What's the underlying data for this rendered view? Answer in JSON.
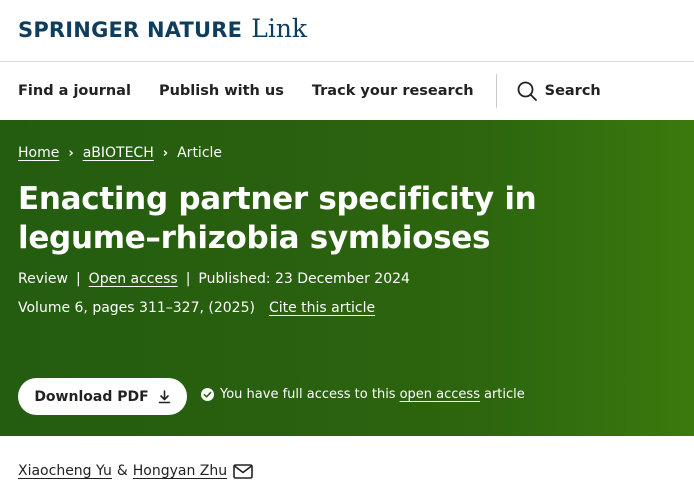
{
  "brand": {
    "name": "SPRINGER NATURE",
    "sub": "Link"
  },
  "nav": {
    "items": [
      "Find a journal",
      "Publish with us",
      "Track your research"
    ],
    "search_label": "Search"
  },
  "breadcrumb": {
    "home": "Home",
    "journal": "aBIOTECH",
    "current": "Article"
  },
  "article": {
    "title": "Enacting partner specificity in legume–rhizobia symbioses",
    "type": "Review",
    "open_access": "Open access",
    "published": "Published: 23 December 2024",
    "volume": "Volume 6, pages 311–327, (2025)",
    "cite": "Cite this article"
  },
  "download": {
    "label": "Download PDF"
  },
  "access_note": {
    "prefix": "You have full access to this",
    "link": "open access",
    "suffix": "article"
  },
  "authors": {
    "first": "Xiaocheng Yu",
    "amp": "&",
    "second": "Hongyan Zhu"
  },
  "colors": {
    "hero_green": "#2d660e",
    "brand_navy": "#0f3d5e"
  },
  "icons": [
    "search-icon",
    "download-icon",
    "check-circle-icon",
    "mail-icon"
  ]
}
